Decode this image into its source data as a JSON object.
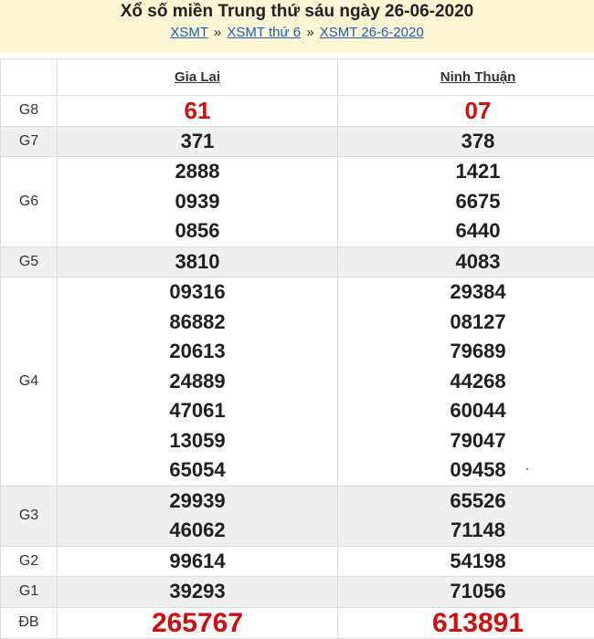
{
  "header": {
    "title": "Xổ số miền Trung thứ sáu ngày 26-06-2020",
    "breadcrumb": [
      {
        "label": "XSMT"
      },
      {
        "label": "XSMT thứ 6"
      },
      {
        "label": "XSMT 26-6-2020"
      }
    ],
    "separator": "»"
  },
  "table": {
    "provinces": [
      "Gia Lai",
      "Ninh Thuận"
    ],
    "rows": [
      {
        "label": "G8",
        "shade": false,
        "style": "red big",
        "values": [
          [
            "61"
          ],
          [
            "07"
          ]
        ]
      },
      {
        "label": "G7",
        "shade": true,
        "style": "",
        "values": [
          [
            "371"
          ],
          [
            "378"
          ]
        ]
      },
      {
        "label": "G6",
        "shade": false,
        "style": "",
        "values": [
          [
            "2888",
            "0939",
            "0856"
          ],
          [
            "1421",
            "6675",
            "6440"
          ]
        ]
      },
      {
        "label": "G5",
        "shade": true,
        "style": "",
        "values": [
          [
            "3810"
          ],
          [
            "4083"
          ]
        ]
      },
      {
        "label": "G4",
        "shade": false,
        "style": "",
        "values": [
          [
            "09316",
            "86882",
            "20613",
            "24889",
            "47061",
            "13059",
            "65054"
          ],
          [
            "29384",
            "08127",
            "79689",
            "44268",
            "60044",
            "79047",
            "09458"
          ]
        ]
      },
      {
        "label": "G3",
        "shade": true,
        "style": "",
        "values": [
          [
            "29939",
            "46062"
          ],
          [
            "65526",
            "71148"
          ]
        ]
      },
      {
        "label": "G2",
        "shade": false,
        "style": "",
        "values": [
          [
            "99614"
          ],
          [
            "54198"
          ]
        ]
      },
      {
        "label": "G1",
        "shade": true,
        "style": "",
        "values": [
          [
            "39293"
          ],
          [
            "71056"
          ]
        ]
      },
      {
        "label": "ĐB",
        "shade": false,
        "style": "red jackpot",
        "values": [
          [
            "265767"
          ],
          [
            "613891"
          ]
        ]
      }
    ]
  },
  "colors": {
    "header_bg": "#fdf6d4",
    "link": "#1a5fb4",
    "prize_red": "#d10f0f",
    "row_shade": "#efefef"
  }
}
